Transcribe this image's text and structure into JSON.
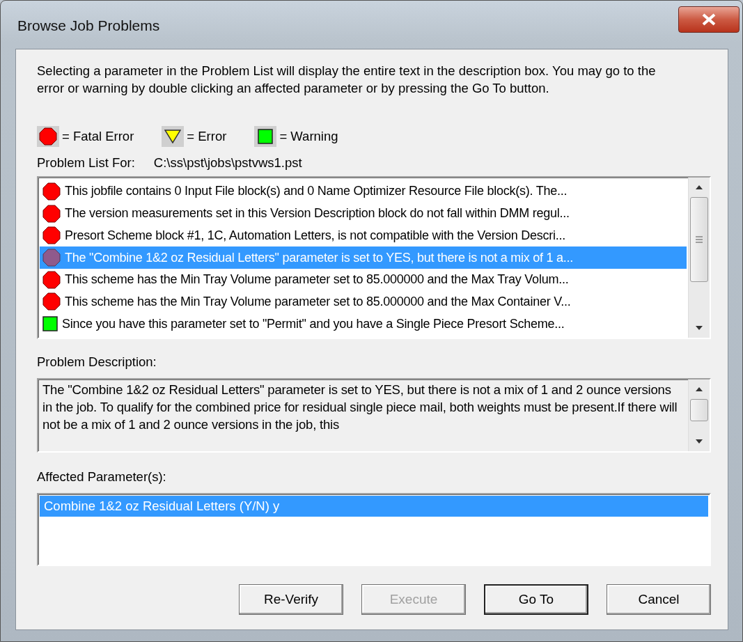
{
  "window": {
    "title": "Browse Job Problems"
  },
  "intro": "Selecting a parameter in the Problem List will display the entire text in the description box.  You may go to the error or warning by double clicking an affected parameter or by pressing the Go To button.",
  "legend": [
    {
      "kind": "fatal",
      "label": "= Fatal Error"
    },
    {
      "kind": "error",
      "label": "= Error"
    },
    {
      "kind": "warning",
      "label": "= Warning"
    }
  ],
  "problem_list_for": {
    "label": "Problem List For:",
    "path": "C:\\ss\\pst\\jobs\\pstvws1.pst"
  },
  "problems": [
    {
      "kind": "fatal",
      "selected": false,
      "text": "This jobfile contains 0 Input File block(s) and 0 Name Optimizer Resource File block(s).  The..."
    },
    {
      "kind": "fatal",
      "selected": false,
      "text": "The version measurements set in this Version Description block do not fall within DMM regul..."
    },
    {
      "kind": "fatal",
      "selected": false,
      "text": "Presort Scheme block #1, 1C, Automation Letters, is not compatible with the Version Descri..."
    },
    {
      "kind": "fatal",
      "selected": true,
      "text": "The \"Combine 1&2 oz Residual Letters\" parameter is set to YES, but there is not a mix of 1 a..."
    },
    {
      "kind": "fatal",
      "selected": false,
      "text": "This scheme has the Min Tray Volume parameter set to 85.000000 and the Max Tray Volum..."
    },
    {
      "kind": "fatal",
      "selected": false,
      "text": "This scheme has the Min Tray Volume parameter set to 85.000000 and the Max Container V..."
    },
    {
      "kind": "warning",
      "selected": false,
      "text": "Since you have this parameter set to \"Permit\" and you have a Single Piece Presort Scheme..."
    }
  ],
  "description": {
    "label": "Problem Description:",
    "text": "The \"Combine 1&2 oz Residual Letters\" parameter is set to YES, but there is not a mix of 1 and 2 ounce versions in the job. To qualify for the combined price for residual single piece mail, both weights must be present.If there will not be a mix of 1 and 2 ounce versions in the job, this"
  },
  "affected": {
    "label": "Affected Parameter(s):",
    "items": [
      {
        "text": "Combine 1&2 oz Residual Letters (Y/N) y",
        "selected": true
      }
    ]
  },
  "buttons": [
    {
      "label": "Re-Verify",
      "disabled": false,
      "default": false
    },
    {
      "label": "Execute",
      "disabled": true,
      "default": false
    },
    {
      "label": "Go To",
      "disabled": false,
      "default": true
    },
    {
      "label": "Cancel",
      "disabled": false,
      "default": false
    }
  ]
}
